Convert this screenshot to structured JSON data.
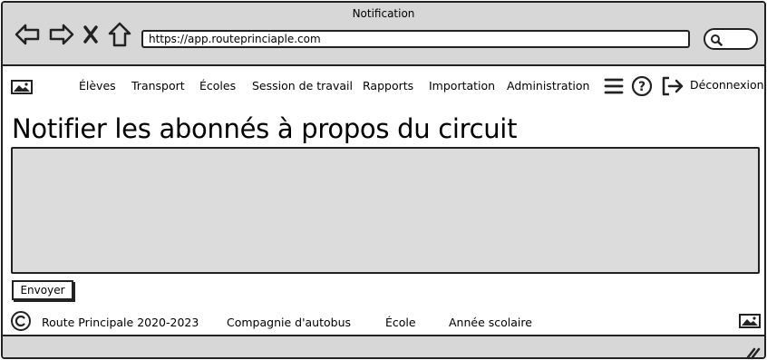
{
  "window": {
    "title": "Notification"
  },
  "browser": {
    "url": "https://app.routeprinciaple.com",
    "icons": [
      "back-arrow-icon",
      "forward-arrow-icon",
      "close-icon",
      "home-icon",
      "search-icon"
    ]
  },
  "nav": {
    "items": [
      {
        "label": "Élèves"
      },
      {
        "label": "Transport"
      },
      {
        "label": "Écoles"
      },
      {
        "label": "Session de travail"
      },
      {
        "label": "Rapports"
      },
      {
        "label": "Importation"
      },
      {
        "label": "Administration"
      }
    ],
    "logout_label": "Déconnexion",
    "icons": [
      "logo-image-icon",
      "hamburger-menu-icon",
      "help-icon",
      "logout-icon"
    ]
  },
  "main": {
    "title": "Notifier les abonnés à propos du circuit",
    "message_value": "",
    "send_label": "Envoyer"
  },
  "footer": {
    "copyright": "Route Principale 2020-2023",
    "links": [
      {
        "label": "Compagnie d'autobus"
      },
      {
        "label": "École"
      },
      {
        "label": "Année scolaire"
      }
    ]
  },
  "colors": {
    "chrome": "#d7d7d7",
    "textarea": "#dcdcdc",
    "stroke": "#222222"
  }
}
